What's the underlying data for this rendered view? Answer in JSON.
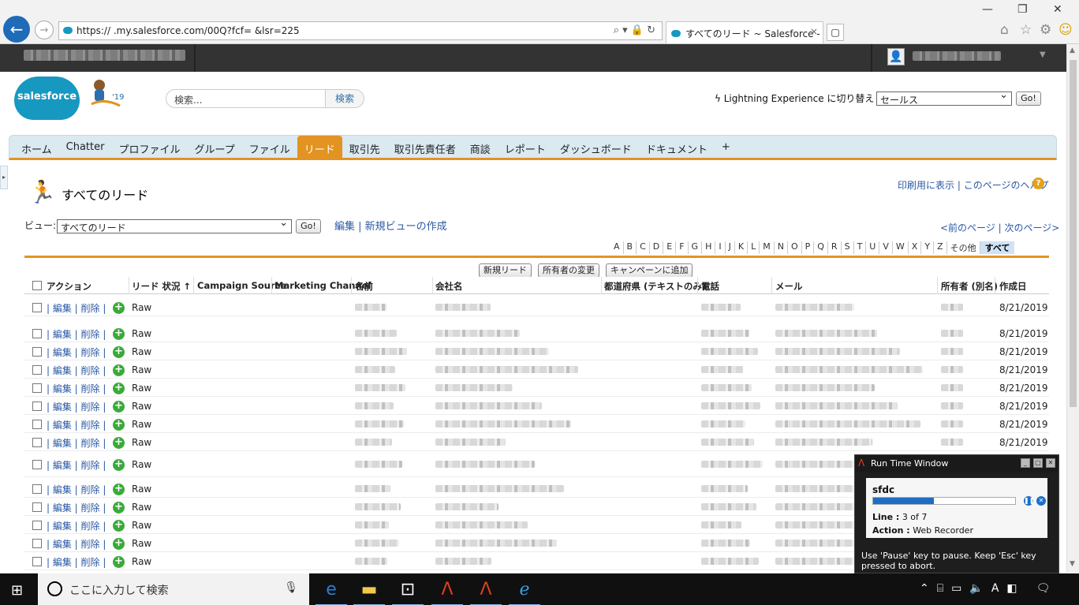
{
  "browser": {
    "url": "https://      .my.salesforce.com/00Q?fcf=             &lsr=225",
    "tab_title": "すべてのリード ~ Salesforce - ...",
    "tab_close": "×"
  },
  "header": {
    "logo_text": "salesforce",
    "mascot_badge": "'19",
    "search_placeholder": "検索...",
    "search_button": "検索",
    "lightning_link": "Lightning Experience に切り替え",
    "app_selected": "セールス",
    "go": "Go!"
  },
  "tabs": [
    "ホーム",
    "Chatter",
    "プロファイル",
    "グループ",
    "ファイル",
    "リード",
    "取引先",
    "取引先責任者",
    "商談",
    "レポート",
    "ダッシュボード",
    "ドキュメント",
    "+"
  ],
  "page": {
    "title": "すべてのリード",
    "print_link": "印刷用に表示",
    "help_link": "このページのヘルプ",
    "view_label": "ビュー:",
    "view_selected": "すべてのリード",
    "view_go": "Go!",
    "edit_link": "編集",
    "new_view_link": "新規ビューの作成",
    "prev_page": "<前のページ",
    "next_page": "次のページ>",
    "alphabet": [
      "A",
      "B",
      "C",
      "D",
      "E",
      "F",
      "G",
      "H",
      "I",
      "J",
      "K",
      "L",
      "M",
      "N",
      "O",
      "P",
      "Q",
      "R",
      "S",
      "T",
      "U",
      "V",
      "W",
      "X",
      "Y",
      "Z",
      "その他",
      "すべて"
    ]
  },
  "table": {
    "buttons": [
      "新規リード",
      "所有者の変更",
      "キャンペーンに追加"
    ],
    "columns": [
      "アクション",
      "リード 状況 ↑",
      "Campaign Source",
      "Marketing Channel",
      "名前",
      "会社名",
      "都道府県 (テキストのみ)",
      "電話",
      "メール",
      "所有者 (別名)",
      "作成日"
    ],
    "row_actions": "| 編集 | 削除 |",
    "rows": [
      {
        "status": "Raw",
        "date": "8/21/2019"
      },
      {
        "status": "Raw",
        "date": "8/21/2019"
      },
      {
        "status": "Raw",
        "date": "8/21/2019"
      },
      {
        "status": "Raw",
        "date": "8/21/2019"
      },
      {
        "status": "Raw",
        "date": "8/21/2019"
      },
      {
        "status": "Raw",
        "date": "8/21/2019"
      },
      {
        "status": "Raw",
        "date": "8/21/2019"
      },
      {
        "status": "Raw",
        "date": "8/21/2019"
      },
      {
        "status": "Raw",
        "date": "8/21/2019"
      },
      {
        "status": "Raw",
        "date": "8/21/2019"
      },
      {
        "status": "Raw",
        "date": "8/21/2019"
      },
      {
        "status": "Raw",
        "date": "8/21/2019"
      },
      {
        "status": "Raw",
        "date": "8/21/2019"
      },
      {
        "status": "Raw",
        "date": "8/21/2019"
      }
    ]
  },
  "runtime": {
    "title": "Run Time Window",
    "name": "sfdc",
    "progress": 0.43,
    "line_label": "Line :",
    "line_value": "3 of 7",
    "action_label": "Action :",
    "action_value": "Web Recorder",
    "message": "Use 'Pause' key to pause. Keep 'Esc' key pressed to abort."
  },
  "taskbar": {
    "search_placeholder": "ここに入力して検索"
  }
}
